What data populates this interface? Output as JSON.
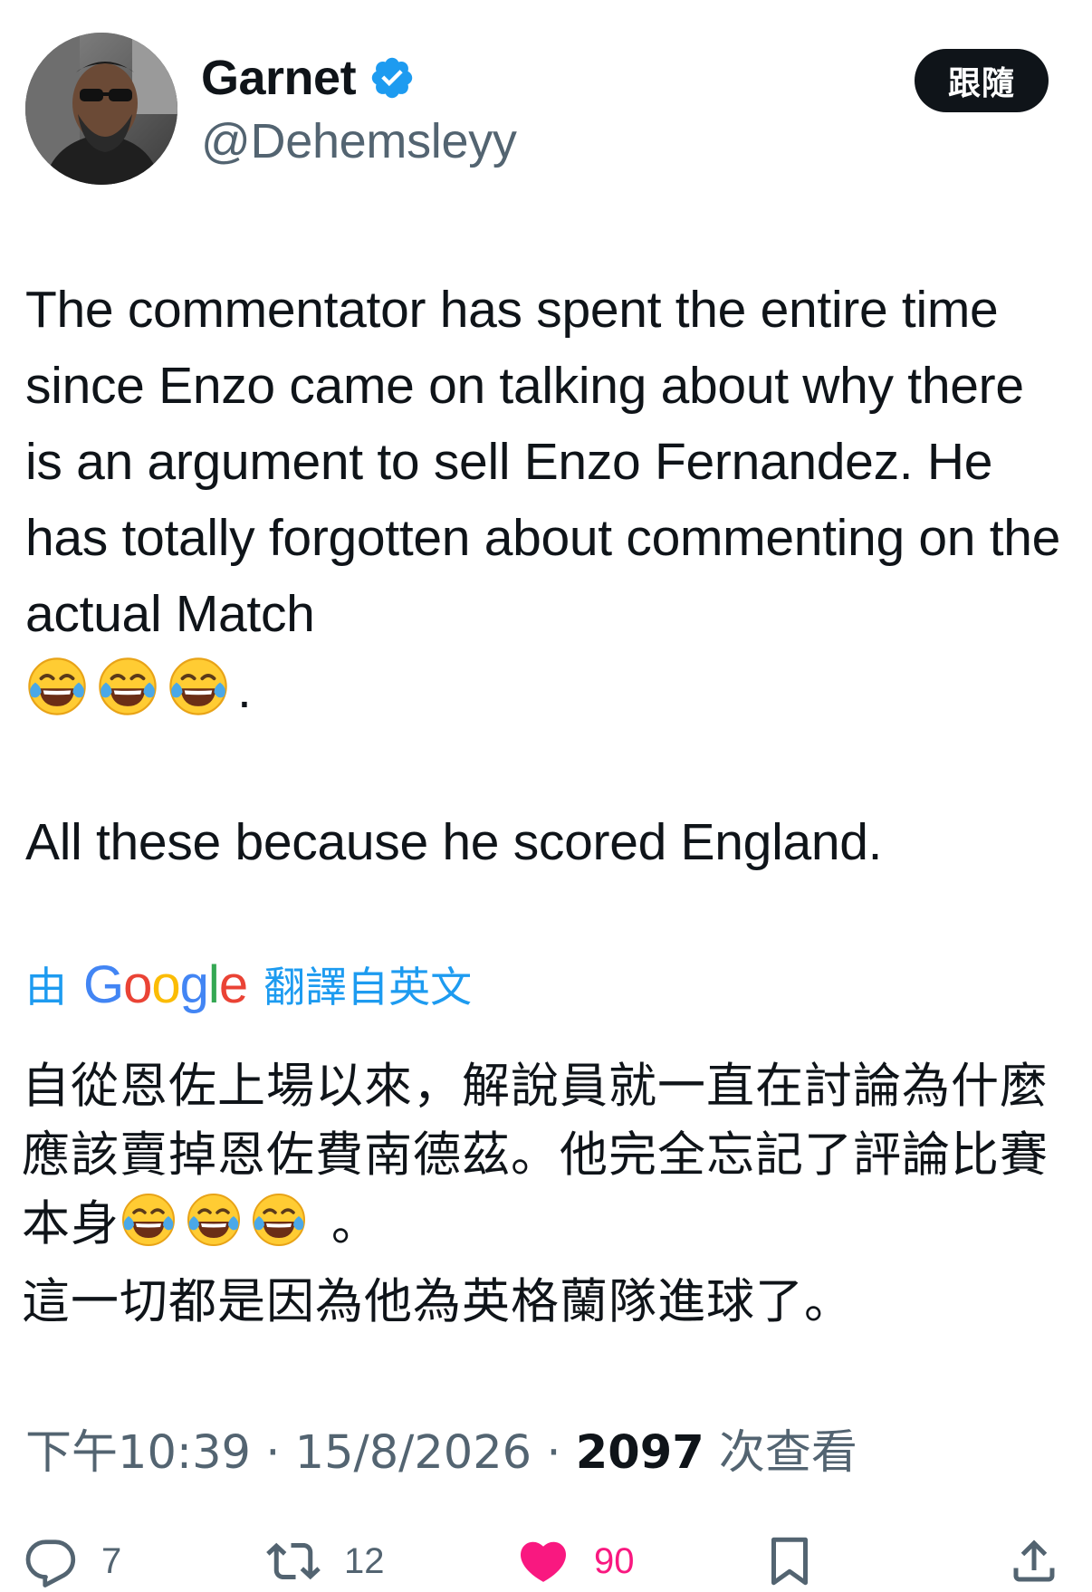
{
  "author": {
    "display_name": "Garnet",
    "handle": "@Dehemsleyy",
    "verified": true,
    "verified_color": "#1d9bf0"
  },
  "follow_button": {
    "label": "跟隨"
  },
  "tweet": {
    "paragraph_1": "The commentator has spent the entire time since Enzo came on talking about why there is an argument to sell Enzo Fernandez. He has totally forgotten about commenting on the actual Match",
    "paragraph_1_end": ".",
    "paragraph_2": "All these because he scored England.",
    "emoji": "face-with-tears-of-joy"
  },
  "translation": {
    "prefix": "由",
    "provider": "Google",
    "suffix": "翻譯自英文",
    "paragraph_1": "自從恩佐上場以來，解說員就一直在討論為什麼應該賣掉恩佐費南德茲。他完全忘記了評論比賽本身",
    "paragraph_1_end": " 。",
    "paragraph_2": "這一切都是因為他為英格蘭隊進球了。"
  },
  "meta": {
    "time": "下午10:39",
    "separator": " · ",
    "date": "15/8/2026",
    "views_count": "2097",
    "views_label": " 次查看"
  },
  "actions": {
    "replies": "7",
    "reposts": "12",
    "likes": "90",
    "like_color": "#f91880"
  }
}
